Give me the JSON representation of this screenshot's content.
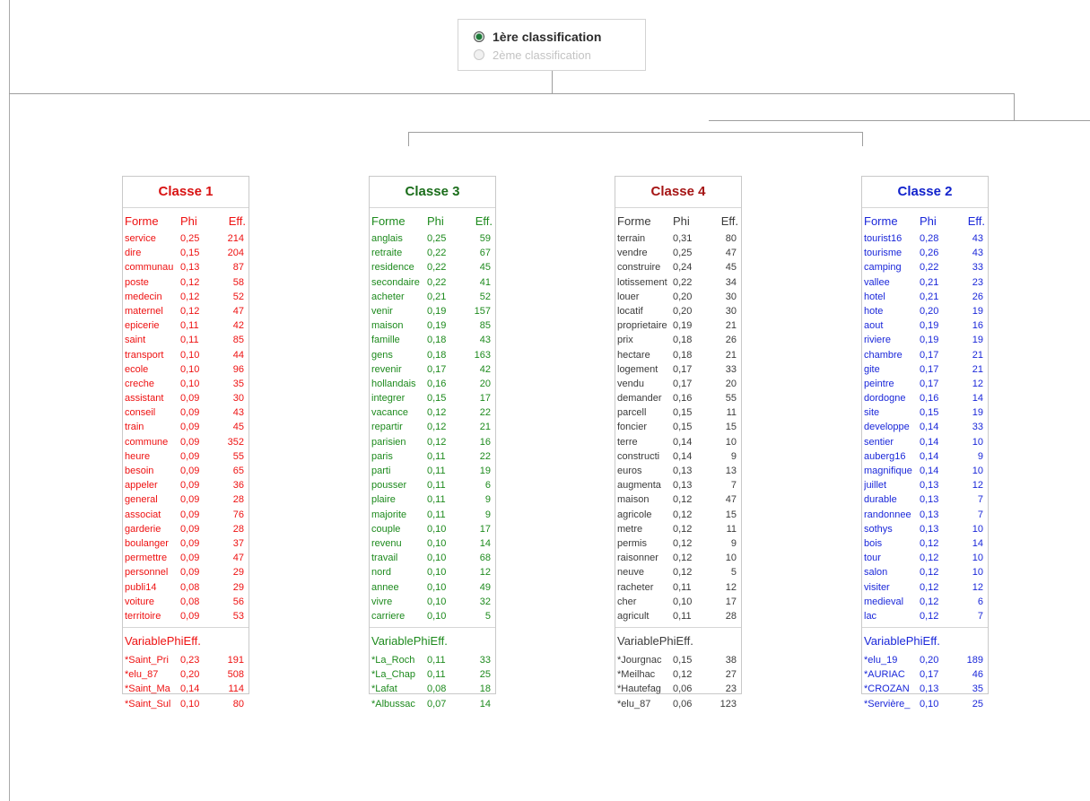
{
  "radio": {
    "first_label": "1ère classification",
    "second_label": "2ème classification"
  },
  "columns": {
    "forme": "Forme",
    "variable": "Variable",
    "phi": "Phi",
    "eff": "Eff."
  },
  "classes": [
    {
      "title": "Classe 1",
      "color": "#ee1111",
      "formes": [
        [
          "service",
          "0,25",
          "214"
        ],
        [
          "dire",
          "0,15",
          "204"
        ],
        [
          "communau",
          "0,13",
          "87"
        ],
        [
          "poste",
          "0,12",
          "58"
        ],
        [
          "medecin",
          "0,12",
          "52"
        ],
        [
          "maternel",
          "0,12",
          "47"
        ],
        [
          "epicerie",
          "0,11",
          "42"
        ],
        [
          "saint",
          "0,11",
          "85"
        ],
        [
          "transport",
          "0,10",
          "44"
        ],
        [
          "ecole",
          "0,10",
          "96"
        ],
        [
          "creche",
          "0,10",
          "35"
        ],
        [
          "assistant",
          "0,09",
          "30"
        ],
        [
          "conseil",
          "0,09",
          "43"
        ],
        [
          "train",
          "0,09",
          "45"
        ],
        [
          "commune",
          "0,09",
          "352"
        ],
        [
          "heure",
          "0,09",
          "55"
        ],
        [
          "besoin",
          "0,09",
          "65"
        ],
        [
          "appeler",
          "0,09",
          "36"
        ],
        [
          "general",
          "0,09",
          "28"
        ],
        [
          "associat",
          "0,09",
          "76"
        ],
        [
          "garderie",
          "0,09",
          "28"
        ],
        [
          "boulanger",
          "0,09",
          "37"
        ],
        [
          "permettre",
          "0,09",
          "47"
        ],
        [
          "personnel",
          "0,09",
          "29"
        ],
        [
          "publi14",
          "0,08",
          "29"
        ],
        [
          "voiture",
          "0,08",
          "56"
        ],
        [
          "territoire",
          "0,09",
          "53"
        ]
      ],
      "variables": [
        [
          "*Saint_Pri",
          "0,23",
          "191"
        ],
        [
          "*elu_87",
          "0,20",
          "508"
        ],
        [
          "*Saint_Ma",
          "0,14",
          "114"
        ],
        [
          "*Saint_Sul",
          "0,10",
          "80"
        ]
      ]
    },
    {
      "title": "Classe 3",
      "color": "#1d8a1d",
      "formes": [
        [
          "anglais",
          "0,25",
          "59"
        ],
        [
          "retraite",
          "0,22",
          "67"
        ],
        [
          "residence",
          "0,22",
          "45"
        ],
        [
          "secondaire",
          "0,22",
          "41"
        ],
        [
          "acheter",
          "0,21",
          "52"
        ],
        [
          "venir",
          "0,19",
          "157"
        ],
        [
          "maison",
          "0,19",
          "85"
        ],
        [
          "famille",
          "0,18",
          "43"
        ],
        [
          "gens",
          "0,18",
          "163"
        ],
        [
          "revenir",
          "0,17",
          "42"
        ],
        [
          "hollandais",
          "0,16",
          "20"
        ],
        [
          "integrer",
          "0,15",
          "17"
        ],
        [
          "vacance",
          "0,12",
          "22"
        ],
        [
          "repartir",
          "0,12",
          "21"
        ],
        [
          "parisien",
          "0,12",
          "16"
        ],
        [
          "paris",
          "0,11",
          "22"
        ],
        [
          "parti",
          "0,11",
          "19"
        ],
        [
          "pousser",
          "0,11",
          "6"
        ],
        [
          "plaire",
          "0,11",
          "9"
        ],
        [
          "majorite",
          "0,11",
          "9"
        ],
        [
          "couple",
          "0,10",
          "17"
        ],
        [
          "revenu",
          "0,10",
          "14"
        ],
        [
          "travail",
          "0,10",
          "68"
        ],
        [
          "nord",
          "0,10",
          "12"
        ],
        [
          "annee",
          "0,10",
          "49"
        ],
        [
          "vivre",
          "0,10",
          "32"
        ],
        [
          "carriere",
          "0,10",
          "5"
        ]
      ],
      "variables": [
        [
          "*La_Roch",
          "0,11",
          "33"
        ],
        [
          "*La_Chap",
          "0,11",
          "25"
        ],
        [
          "*Lafat",
          "0,08",
          "18"
        ],
        [
          "*Albussac",
          "0,07",
          "14"
        ]
      ]
    },
    {
      "title": "Classe 4",
      "color": "#b31212",
      "formes": [
        [
          "terrain",
          "0,31",
          "80"
        ],
        [
          "vendre",
          "0,25",
          "47"
        ],
        [
          "construire",
          "0,24",
          "45"
        ],
        [
          "lotissement",
          "0,22",
          "34"
        ],
        [
          "louer",
          "0,20",
          "30"
        ],
        [
          "locatif",
          "0,20",
          "30"
        ],
        [
          "proprietaire",
          "0,19",
          "21"
        ],
        [
          "prix",
          "0,18",
          "26"
        ],
        [
          "hectare",
          "0,18",
          "21"
        ],
        [
          "logement",
          "0,17",
          "33"
        ],
        [
          "vendu",
          "0,17",
          "20"
        ],
        [
          "demander",
          "0,16",
          "55"
        ],
        [
          "parcell",
          "0,15",
          "11"
        ],
        [
          "foncier",
          "0,15",
          "15"
        ],
        [
          "terre",
          "0,14",
          "10"
        ],
        [
          "constructi",
          "0,14",
          "9"
        ],
        [
          "euros",
          "0,13",
          "13"
        ],
        [
          "augmenta",
          "0,13",
          "7"
        ],
        [
          "maison",
          "0,12",
          "47"
        ],
        [
          "agricole",
          "0,12",
          "15"
        ],
        [
          "metre",
          "0,12",
          "11"
        ],
        [
          "permis",
          "0,12",
          "9"
        ],
        [
          "raisonner",
          "0,12",
          "10"
        ],
        [
          "neuve",
          "0,12",
          "5"
        ],
        [
          "racheter",
          "0,11",
          "12"
        ],
        [
          "cher",
          "0,10",
          "17"
        ],
        [
          "agricult",
          "0,11",
          "28"
        ]
      ],
      "variables": [
        [
          "*Jourgnac",
          "0,15",
          "38"
        ],
        [
          "*Meilhac",
          "0,12",
          "27"
        ],
        [
          "*Hautefag",
          "0,06",
          "23"
        ],
        [
          "*elu_87",
          "0,06",
          "123"
        ]
      ]
    },
    {
      "title": "Classe 2",
      "color": "#1a27d9",
      "formes": [
        [
          "tourist16",
          "0,28",
          "43"
        ],
        [
          "tourisme",
          "0,26",
          "43"
        ],
        [
          "camping",
          "0,22",
          "33"
        ],
        [
          "vallee",
          "0,21",
          "23"
        ],
        [
          "hotel",
          "0,21",
          "26"
        ],
        [
          "hote",
          "0,20",
          "19"
        ],
        [
          "aout",
          "0,19",
          "16"
        ],
        [
          "riviere",
          "0,19",
          "19"
        ],
        [
          "chambre",
          "0,17",
          "21"
        ],
        [
          "gite",
          "0,17",
          "21"
        ],
        [
          "peintre",
          "0,17",
          "12"
        ],
        [
          "dordogne",
          "0,16",
          "14"
        ],
        [
          "site",
          "0,15",
          "19"
        ],
        [
          "developpe",
          "0,14",
          "33"
        ],
        [
          "sentier",
          "0,14",
          "10"
        ],
        [
          "auberg16",
          "0,14",
          "9"
        ],
        [
          "magnifique",
          "0,14",
          "10"
        ],
        [
          "juillet",
          "0,13",
          "12"
        ],
        [
          "durable",
          "0,13",
          "7"
        ],
        [
          "randonnee",
          "0,13",
          "7"
        ],
        [
          "sothys",
          "0,13",
          "10"
        ],
        [
          "bois",
          "0,12",
          "14"
        ],
        [
          "tour",
          "0,12",
          "10"
        ],
        [
          "salon",
          "0,12",
          "10"
        ],
        [
          "visiter",
          "0,12",
          "12"
        ],
        [
          "medieval",
          "0,12",
          "6"
        ],
        [
          "lac",
          "0,12",
          "7"
        ]
      ],
      "variables": [
        [
          "*elu_19",
          "0,20",
          "189"
        ],
        [
          "*AURIAC",
          "0,17",
          "46"
        ],
        [
          "*CROZAN",
          "0,13",
          "35"
        ],
        [
          "*Servière_",
          "0,10",
          "25"
        ]
      ]
    }
  ]
}
